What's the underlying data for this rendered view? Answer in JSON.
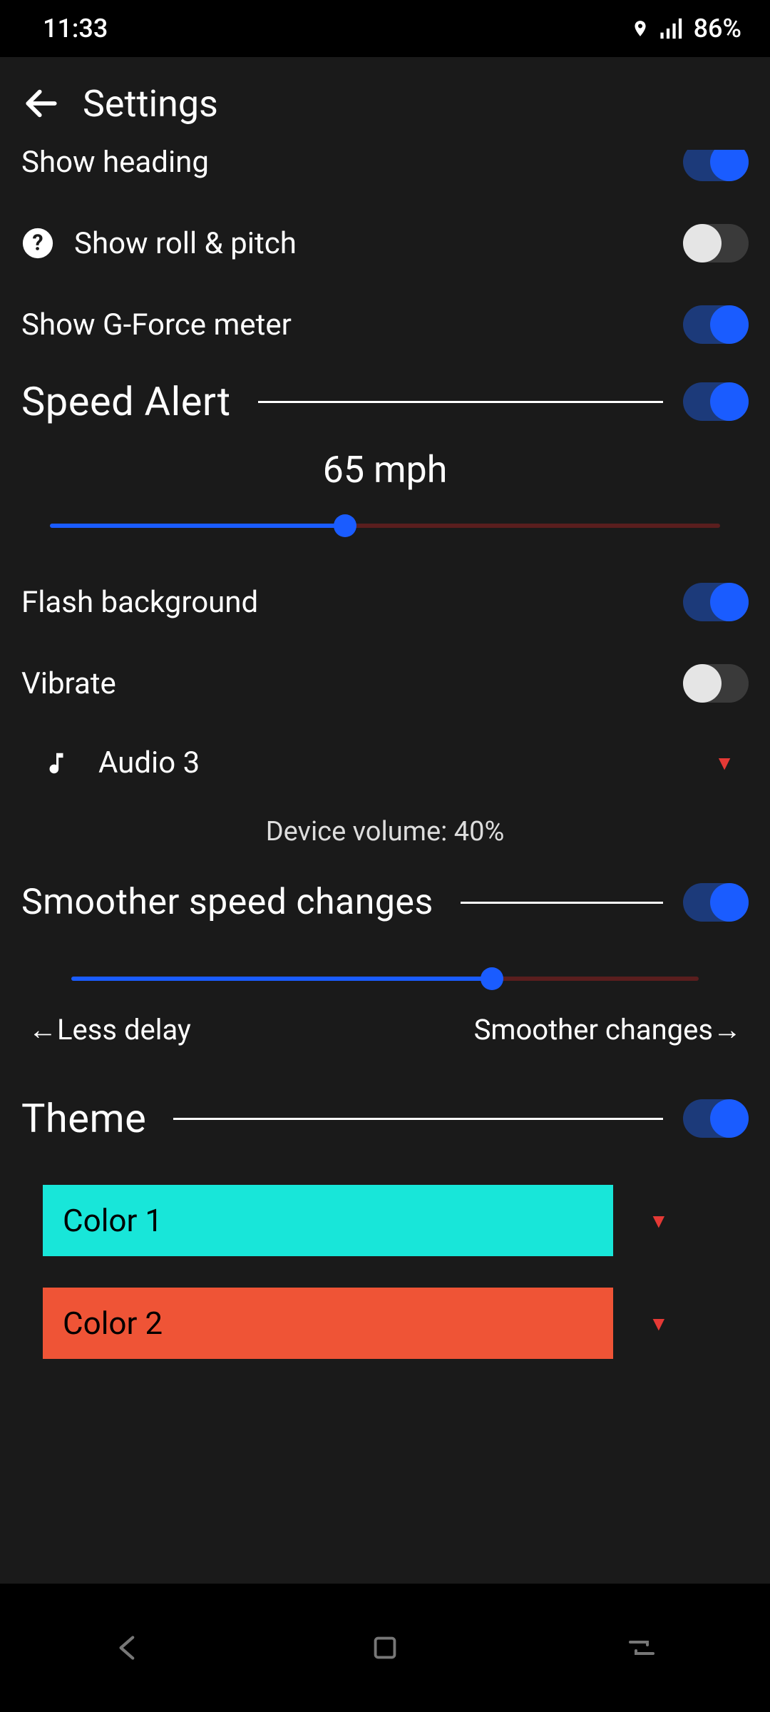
{
  "statusbar": {
    "time": "11:33",
    "battery": "86%"
  },
  "appbar": {
    "title": "Settings"
  },
  "rows": {
    "show_heading": {
      "label": "Show heading",
      "on": true
    },
    "show_roll_pitch": {
      "label": "Show roll & pitch",
      "on": false
    },
    "show_gforce": {
      "label": "Show G-Force meter",
      "on": true
    },
    "speed_alert": {
      "title": "Speed Alert",
      "on": true,
      "value": "65 mph",
      "slider_pct": 44
    },
    "flash_bg": {
      "label": "Flash background",
      "on": true
    },
    "vibrate": {
      "label": "Vibrate",
      "on": false
    },
    "audio": {
      "label": "Audio 3"
    },
    "device_volume": "Device volume: 40%",
    "smoother": {
      "title": "Smoother speed changes",
      "on": true,
      "slider_pct": 67,
      "left_label": "←Less delay",
      "right_label": "Smoother changes→"
    },
    "theme": {
      "title": "Theme",
      "on": true
    },
    "color1": {
      "label": "Color 1",
      "hex": "#18e6d9"
    },
    "color2": {
      "label": "Color 2",
      "hex": "#ef5436"
    }
  }
}
